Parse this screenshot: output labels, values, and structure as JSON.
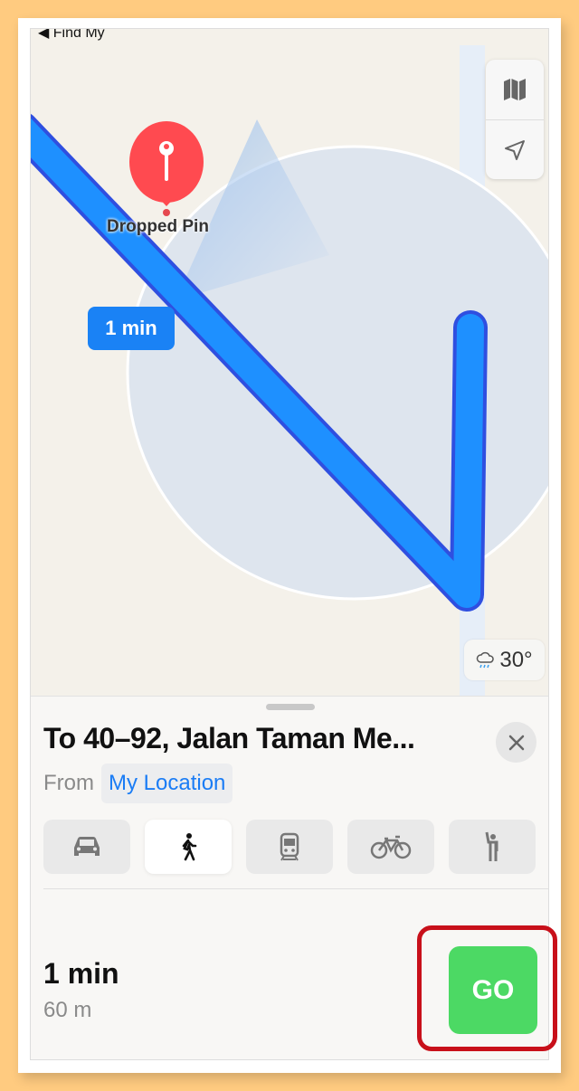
{
  "header": {
    "back_label": "◀ Find My"
  },
  "map": {
    "pin_label": "Dropped Pin",
    "eta_bubble": "1 min",
    "weather": {
      "icon": "cloud-rain-icon",
      "temperature": "30°"
    },
    "controls": [
      {
        "icon": "map-icon"
      },
      {
        "icon": "location-arrow-icon"
      }
    ],
    "colors": {
      "route": "#1E90FF",
      "route_outline": "#2F4FE0",
      "pin": "#FF4A50"
    }
  },
  "sheet": {
    "title": "To 40–92, Jalan Taman Me...",
    "from_label": "From",
    "from_value": "My Location",
    "modes": [
      {
        "icon": "car-icon",
        "name": "Drive",
        "selected": false
      },
      {
        "icon": "walk-icon",
        "name": "Walk",
        "selected": true
      },
      {
        "icon": "train-icon",
        "name": "Transit",
        "selected": false
      },
      {
        "icon": "bicycle-icon",
        "name": "Cycle",
        "selected": false
      },
      {
        "icon": "ride-hail-icon",
        "name": "Ride",
        "selected": false
      }
    ],
    "route": {
      "time": "1 min",
      "distance": "60 m",
      "go_label": "GO"
    },
    "colors": {
      "go": "#4CD964",
      "accent": "#1A7CF5",
      "highlight": "#C8101A"
    }
  }
}
